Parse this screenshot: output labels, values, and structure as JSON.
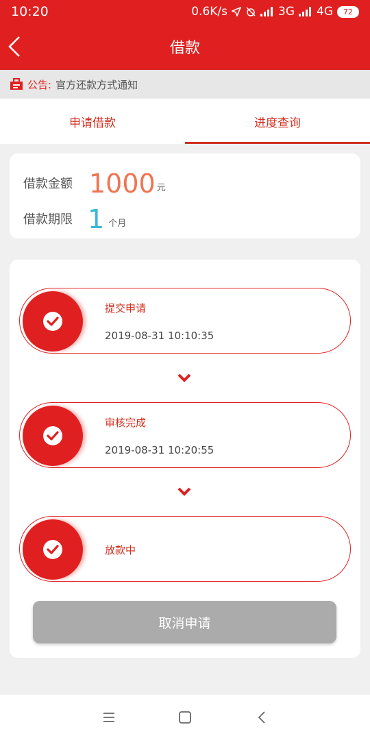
{
  "status_bar": {
    "time": "10:20",
    "net_speed": "0.6K/s",
    "signal_3g": "3G",
    "signal_4g": "4G",
    "battery": "72"
  },
  "header": {
    "title": "借款"
  },
  "notice": {
    "prefix": "公告:",
    "text": "官方还款方式通知"
  },
  "tabs": [
    {
      "label": "申请借款"
    },
    {
      "label": "进度查询",
      "active": true
    }
  ],
  "loan": {
    "amount_label": "借款金额",
    "amount_value": "1000",
    "amount_unit": "元",
    "term_label": "借款期限",
    "term_value": "1",
    "term_unit": "个月"
  },
  "progress": {
    "steps": [
      {
        "name": "提交申请",
        "time": "2019-08-31 10:10:35"
      },
      {
        "name": "审核完成",
        "time": "2019-08-31 10:20:55"
      },
      {
        "name": "放款中"
      }
    ]
  },
  "actions": {
    "cancel_label": "取消申请"
  },
  "colors": {
    "primary": "#e02020",
    "amount": "#ef7452",
    "term": "#36b6d8",
    "disabled_button": "#ababab"
  }
}
